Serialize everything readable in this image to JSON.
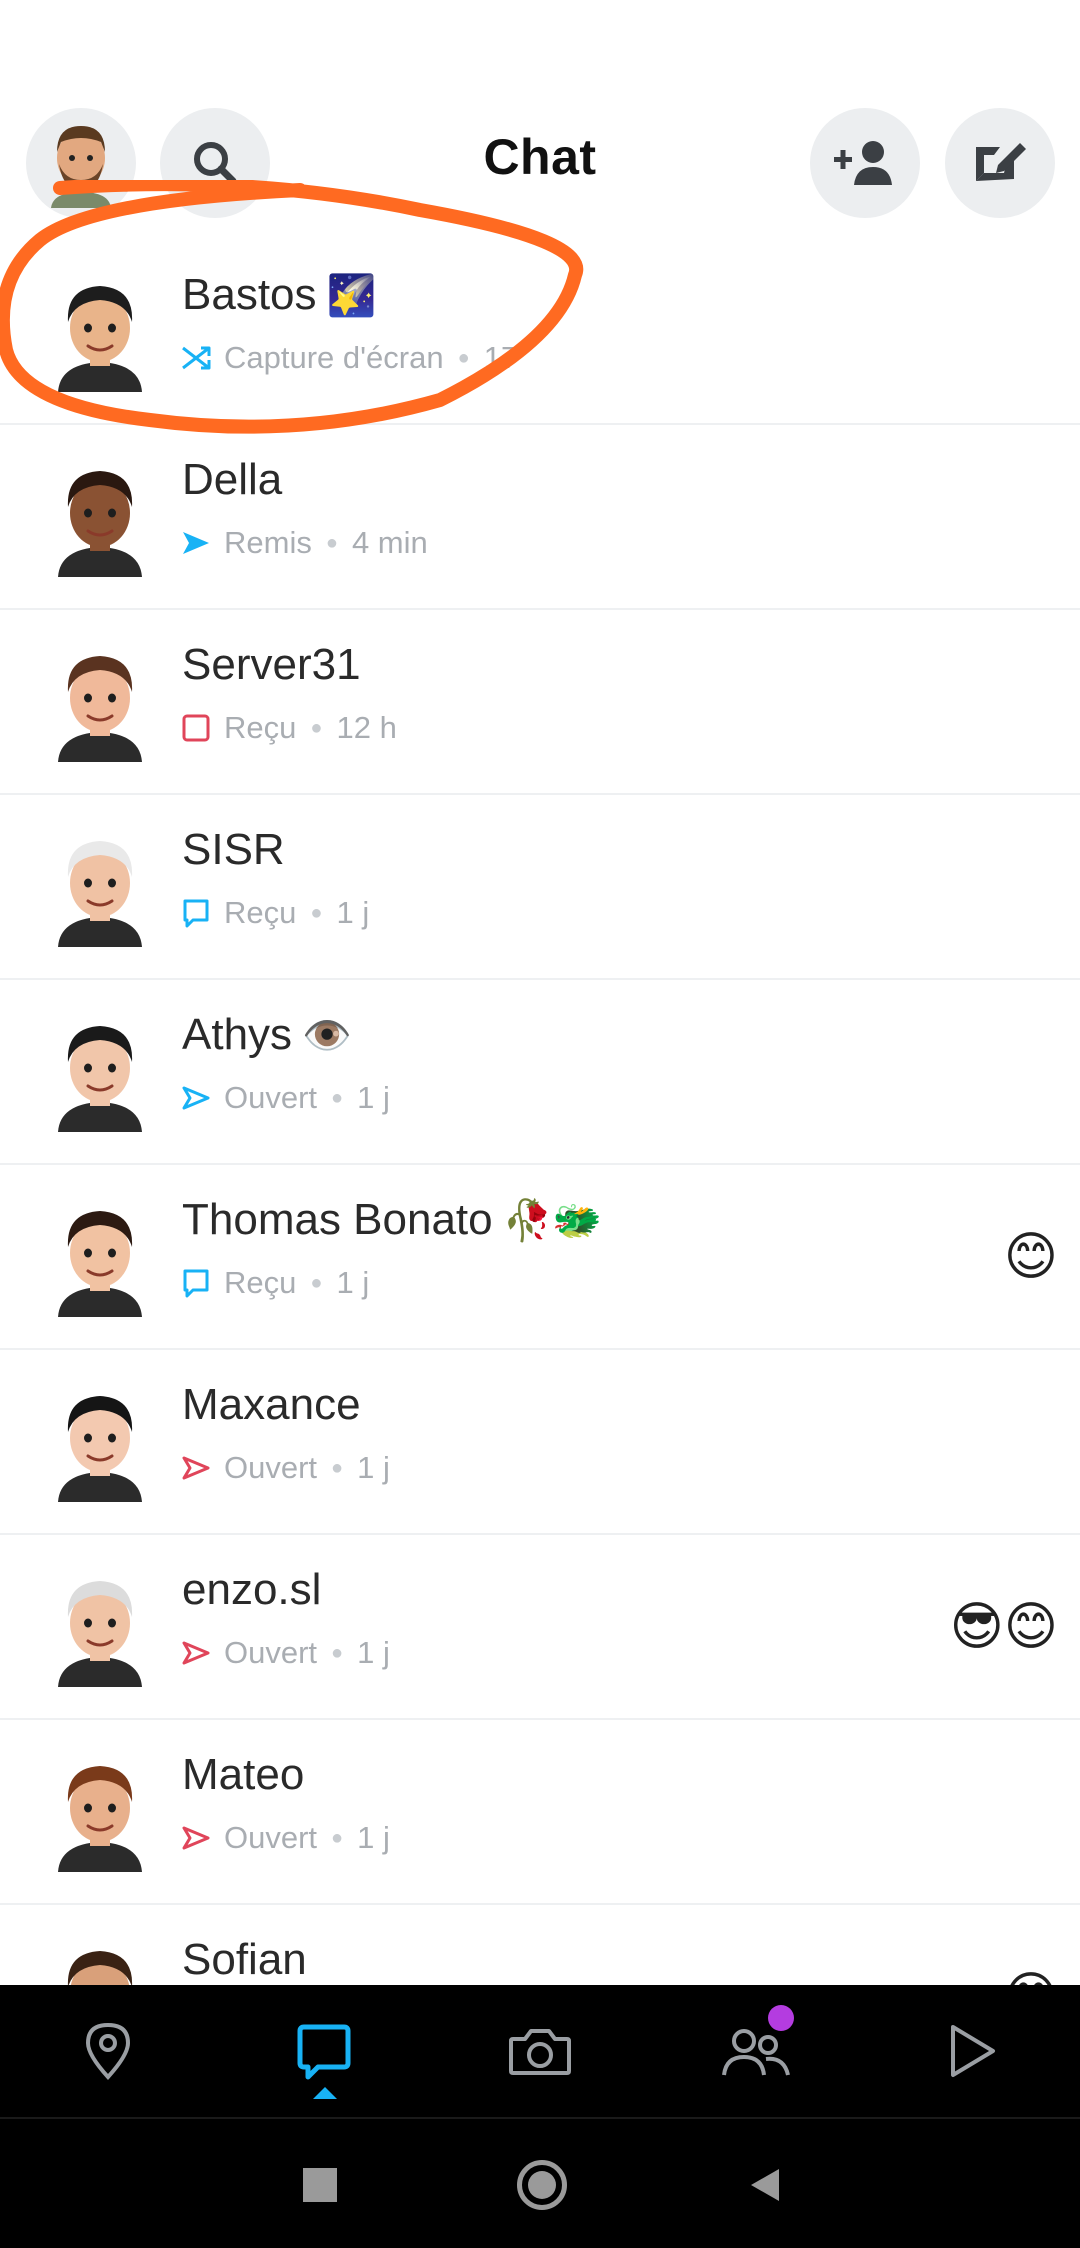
{
  "header": {
    "title": "Chat"
  },
  "chats": [
    {
      "name": "Bastos",
      "name_emoji": "🌠",
      "status": "Capture d'écran",
      "time": "17",
      "status_icon": "screenshot-arrows-icon",
      "status_color": "#18b2f5",
      "avatar_skin": "#e9b48a",
      "avatar_hair": "#1d1d1d",
      "trail": ""
    },
    {
      "name": "Della",
      "name_emoji": "",
      "status": "Remis",
      "time": "4 min",
      "status_icon": "delivered-arrow-icon",
      "status_color": "#18b2f5",
      "avatar_skin": "#8a5233",
      "avatar_hair": "#2a1810",
      "trail": ""
    },
    {
      "name": "Server31",
      "name_emoji": "",
      "status": "Reçu",
      "time": "12 h",
      "status_icon": "received-square-icon",
      "status_color": "#e0455a",
      "avatar_skin": "#f0b99a",
      "avatar_hair": "#5a3320",
      "trail": ""
    },
    {
      "name": "SISR",
      "name_emoji": "",
      "status": "Reçu",
      "time": "1 j",
      "status_icon": "received-chat-icon",
      "status_color": "#18b2f5",
      "avatar_skin": "#f0c2a4",
      "avatar_hair": "#e9e9e9",
      "trail": ""
    },
    {
      "name": "Athys",
      "name_emoji": "👁️",
      "status": "Ouvert",
      "time": "1 j",
      "status_icon": "opened-arrow-icon",
      "status_color": "#18b2f5",
      "avatar_skin": "#f1c6aa",
      "avatar_hair": "#1a1a1a",
      "trail": ""
    },
    {
      "name": "Thomas Bonato",
      "name_emoji": "🥀🐲",
      "status": "Reçu",
      "time": "1 j",
      "status_icon": "received-chat-icon",
      "status_color": "#18b2f5",
      "avatar_skin": "#f1c2a2",
      "avatar_hair": "#2c1a12",
      "trail": "😊"
    },
    {
      "name": "Maxance",
      "name_emoji": "",
      "status": "Ouvert",
      "time": "1 j",
      "status_icon": "opened-arrow-icon",
      "status_color": "#e0455a",
      "avatar_skin": "#f3c9b0",
      "avatar_hair": "#151515",
      "trail": ""
    },
    {
      "name": "enzo.sl",
      "name_emoji": "",
      "status": "Ouvert",
      "time": "1 j",
      "status_icon": "opened-arrow-icon",
      "status_color": "#e0455a",
      "avatar_skin": "#f0c3a5",
      "avatar_hair": "#dcdcdc",
      "trail": "😎😊"
    },
    {
      "name": "Mateo",
      "name_emoji": "",
      "status": "Ouvert",
      "time": "1 j",
      "status_icon": "opened-arrow-icon",
      "status_color": "#e0455a",
      "avatar_skin": "#e8b08c",
      "avatar_hair": "#7a3a1a",
      "trail": ""
    },
    {
      "name": "Sofian",
      "name_emoji": "",
      "status": "",
      "time": "",
      "status_icon": "",
      "status_color": "#e0455a",
      "avatar_skin": "#d9a07a",
      "avatar_hair": "#3a2214",
      "trail": "😊"
    }
  ],
  "nav": {
    "active_color": "#18b2f5",
    "icon_color": "#9a9ea3",
    "badge_color": "#b43ce0",
    "items": [
      "map-pin-icon",
      "chat-icon",
      "camera-icon",
      "friends-icon",
      "play-icon"
    ]
  }
}
